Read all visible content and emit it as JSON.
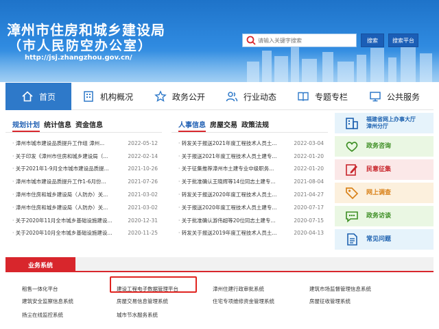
{
  "header": {
    "title": "漳州市住房和城乡建设局",
    "subtitle": "（市人民防空办公室）",
    "url": "http://jsj.zhangzhou.gov.cn/",
    "search": {
      "placeholder": "请输入关键字搜索",
      "search_label": "搜索",
      "search_platform_label": "搜索平台"
    }
  },
  "nav": {
    "items": [
      {
        "label": "首页",
        "icon": "home-icon",
        "active": true
      },
      {
        "label": "机构概况",
        "icon": "building-icon"
      },
      {
        "label": "政务公开",
        "icon": "star-icon"
      },
      {
        "label": "行业动态",
        "icon": "people-icon"
      },
      {
        "label": "专题专栏",
        "icon": "book-icon"
      },
      {
        "label": "公共服务",
        "icon": "monitor-icon"
      }
    ]
  },
  "left_panel": {
    "tabs": [
      "规划计划",
      "统计信息",
      "资金信息"
    ],
    "items": [
      {
        "title": "漳州市城市建设品质提升工作组 漳州...",
        "date": "2022-05-12"
      },
      {
        "title": "关于印发《漳州市住房和城乡建设局（...",
        "date": "2022-02-14"
      },
      {
        "title": "关于2021年1-9月全市城市建设品质提...",
        "date": "2021-10-26"
      },
      {
        "title": "漳州市城市建设品质提升工作1-6月份...",
        "date": "2021-07-26"
      },
      {
        "title": "漳州市住房和城乡建设局（人防办）关...",
        "date": "2021-03-02"
      },
      {
        "title": "漳州市住房和城乡建设局（人防办）关...",
        "date": "2021-03-02"
      },
      {
        "title": "关于2020年11月全市城乡基础设施建设...",
        "date": "2020-12-31"
      },
      {
        "title": "关于2020年10月全市城乡基础设施建设...",
        "date": "2020-11-25"
      }
    ]
  },
  "right_panel": {
    "tabs": [
      "人事信息",
      "房屋交易",
      "政策法规"
    ],
    "items": [
      {
        "title": "转发关于报送2021年度工程技术人员土...",
        "date": "2022-03-04"
      },
      {
        "title": "关于报送2021年度工程技术人员土建专...",
        "date": "2022-01-20"
      },
      {
        "title": "关于征集推荐漳州市土建专业中级职务...",
        "date": "2022-01-20"
      },
      {
        "title": "关于批准确认王晓辉等14位同志土建专...",
        "date": "2021-08-04"
      },
      {
        "title": "转发关于报送2020年度工程技术人员土...",
        "date": "2021-04-27"
      },
      {
        "title": "关于报送2020年度工程技术人员土建专...",
        "date": "2020-07-17"
      },
      {
        "title": "关于批准确认游伟超等20位同志土建专...",
        "date": "2020-07-15"
      },
      {
        "title": "转发关于报送2019年度工程技术人员土...",
        "date": "2020-04-13"
      }
    ]
  },
  "side_services": [
    {
      "label": "福建省网上办事大厅\n漳州分厅",
      "icon": "office-building-icon",
      "bg": "#e6f3fb",
      "color": "#1e62b0"
    },
    {
      "label": "政务咨询",
      "icon": "heart-icon",
      "bg": "#eaf7e3",
      "color": "#3c8e23"
    },
    {
      "label": "民意征集",
      "icon": "pencil-icon",
      "bg": "#fbe8e8",
      "color": "#c8262c"
    },
    {
      "label": "网上调查",
      "icon": "tag-icon",
      "bg": "#fcf0dd",
      "color": "#d9821a"
    },
    {
      "label": "政务访谈",
      "icon": "chat-icon",
      "bg": "#eaf7e3",
      "color": "#3c8e23"
    },
    {
      "label": "常见问题",
      "icon": "document-icon",
      "bg": "#e6f3fb",
      "color": "#1e62b0"
    }
  ],
  "business": {
    "title": "业务系统",
    "systems": [
      "租售一体化平台",
      "建设工程电子数据管理平台",
      "漳州住建行政审批系统",
      "建筑市场监督管理信息系统",
      "建筑安全监察信息系统",
      "房屋交易信息管理系统",
      "住宅专项维修资金管理系统",
      "房屋征收管理系统",
      "扬尘在线监控系统",
      "城市节水服务系统"
    ],
    "highlighted_index": 1
  },
  "colors": {
    "primary": "#2e79c9",
    "accent_red": "#d8262c"
  }
}
